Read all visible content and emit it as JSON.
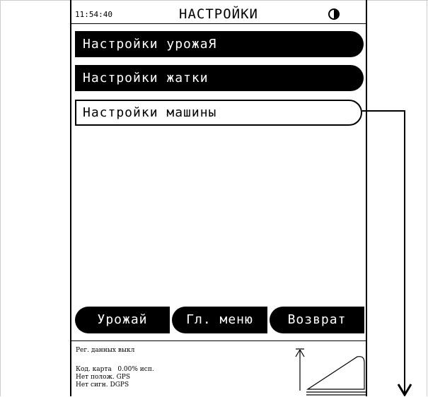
{
  "header": {
    "time": "11:54:40",
    "title": "НАСТРОЙКИ",
    "contrast_icon": "contrast-icon"
  },
  "menu": [
    {
      "label": "Настройки урожаЯ",
      "selected": false
    },
    {
      "label": "Настройки жатки",
      "selected": false
    },
    {
      "label": "Настройки машины",
      "selected": true
    }
  ],
  "softkeys": {
    "yield": "Урожай",
    "main_menu": "Гл. меню",
    "back": "Возврат"
  },
  "status": {
    "logging": "Рег. данных выкл",
    "card": "Код. карта   0.00% исп.",
    "gps": "Нет полож. GPS",
    "dgps": "Нет сигн. DGPS"
  },
  "colors": {
    "foreground": "#000000",
    "background": "#ffffff"
  }
}
